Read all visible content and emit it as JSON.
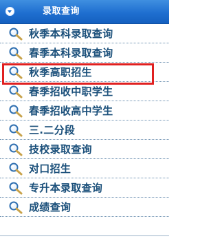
{
  "header": {
    "title": "录取查询",
    "icon": "chevron-down-icon"
  },
  "menu": {
    "items": [
      {
        "label": "秋季本科录取查询",
        "icon": "magnifier-icon"
      },
      {
        "label": "春季本科录取查询",
        "icon": "magnifier-icon"
      },
      {
        "label": "秋季高职招生",
        "icon": "magnifier-icon",
        "highlighted": true
      },
      {
        "label": "春季招收中职学生",
        "icon": "magnifier-icon"
      },
      {
        "label": "春季招收高中学生",
        "icon": "magnifier-icon"
      },
      {
        "label": "三.二分段",
        "icon": "magnifier-icon"
      },
      {
        "label": "技校录取查询",
        "icon": "magnifier-icon"
      },
      {
        "label": "对口招生",
        "icon": "magnifier-icon"
      },
      {
        "label": "专升本录取查询",
        "icon": "magnifier-icon"
      },
      {
        "label": "成绩查询",
        "icon": "magnifier-icon"
      }
    ]
  },
  "colors": {
    "header_bg": "#1f6fd0",
    "label_text": "#1a4f7a",
    "highlight_border": "#e02020"
  }
}
